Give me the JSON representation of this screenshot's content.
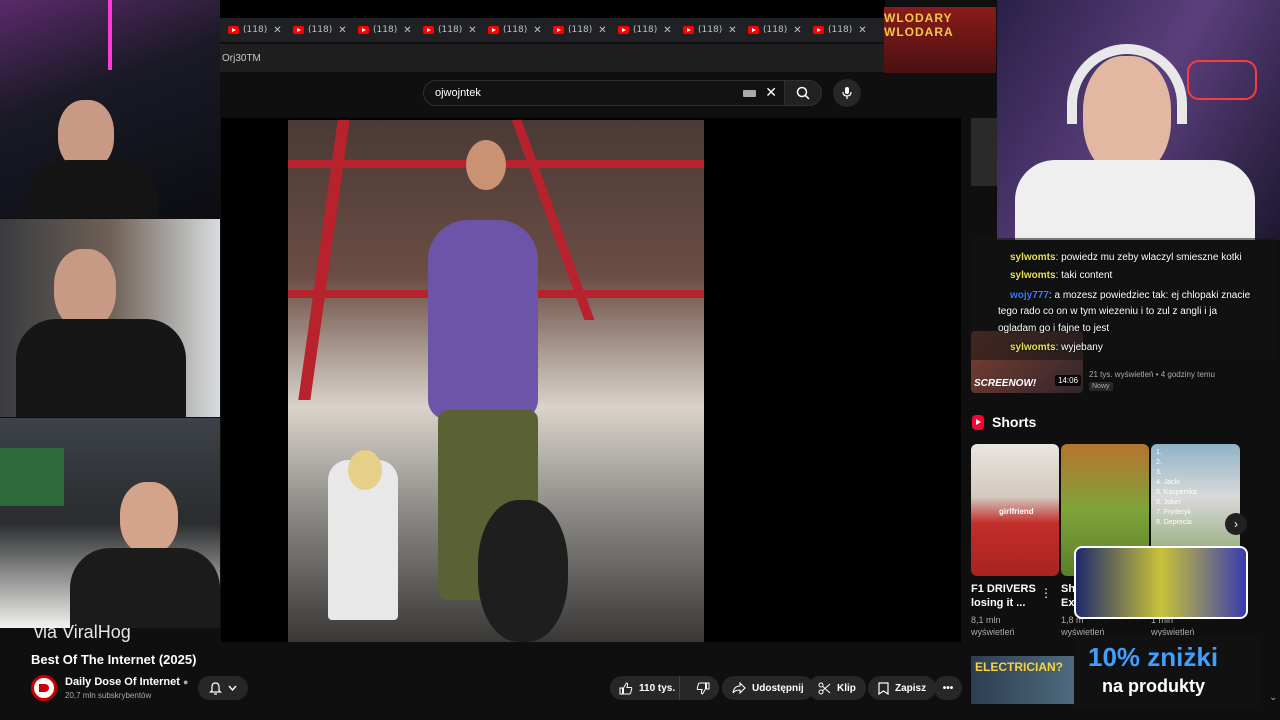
{
  "browser": {
    "tab_label": "(118)",
    "tab_count": 10,
    "url_fragment": "Orj30TM"
  },
  "search": {
    "value": "ojwojntek"
  },
  "video": {
    "caption_overlay": "via ViralHog",
    "title": "Best Of The Internet (2025)",
    "channel_name": "Daily Dose Of Internet",
    "subscribers": "20,7 mln subskrybentów"
  },
  "actions": {
    "likes": "110 tys.",
    "share": "Udostępnij",
    "clip": "Klip",
    "save": "Zapisz"
  },
  "chat": [
    {
      "user": "sylwomts",
      "text": ": powiedz mu zeby wlaczyl smieszne kotki"
    },
    {
      "user": "sylwomts",
      "text": ": taki content"
    },
    {
      "user": "wojy777",
      "text": ": a mozesz powiedziec tak: ej chlopaki znacie"
    },
    {
      "user": "",
      "text": "tego rado co on w tym wiezeniu i to zul z angli i ja"
    },
    {
      "user": "",
      "text": "ogladam go i fajne to jest"
    },
    {
      "user": "sylwomts",
      "text": ": wyjebany"
    }
  ],
  "recommended": {
    "duration": "14:06",
    "thumb_text": "SCREENOW!",
    "meta": "21 tys. wyświetleń • 4 godziny temu",
    "badge": "Nowy"
  },
  "shorts": {
    "heading": "Shorts",
    "items": [
      {
        "title_line1": "F1 DRIVERS",
        "title_line2": "losing it ...",
        "views": "8,1 mln",
        "views_label": "wyświetleń",
        "tag": "girlfriend"
      },
      {
        "title_line1": "Sh",
        "title_line2": "Ex",
        "views": "1,8 m",
        "views_label": "wyświetleń"
      },
      {
        "title_line1": "",
        "title_line2": "",
        "views": "1 mln",
        "views_label": "wyświetleń"
      }
    ],
    "list_overlay": [
      "1.",
      "2.",
      "3.",
      "4. Jacki",
      "5. Kacperska",
      "6. Joker",
      "7. Fryderyk",
      "8. Deprecia"
    ]
  },
  "overlays": {
    "logo_text": "WLODARY WLODARA",
    "discount_big": "10% zniżki",
    "discount_small": "na produkty",
    "electrician": "ELECTRICIAN?"
  },
  "colors": {
    "accent_red": "#ff0000",
    "bg": "#0f0f0f",
    "chat_user": "#e8e054",
    "discount_blue": "#3fa0ff"
  }
}
